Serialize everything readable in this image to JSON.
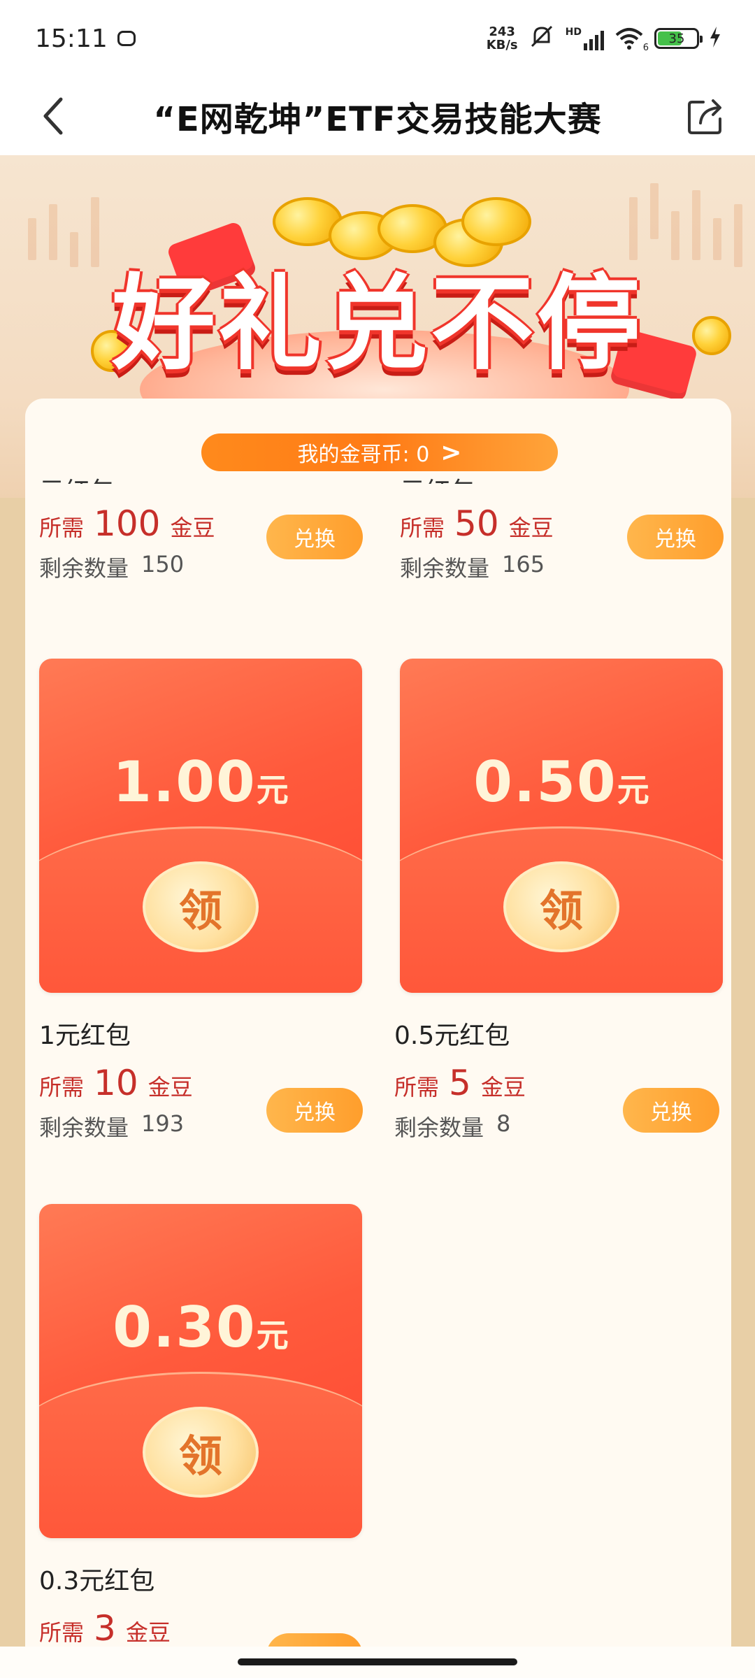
{
  "status_bar": {
    "time": "15:11",
    "net_speed_value": "243",
    "net_speed_unit": "KB/s",
    "hd": "HD",
    "wifi_level": "6",
    "battery": "35"
  },
  "nav": {
    "title": "“E网乾坤”ETF交易技能大赛"
  },
  "banner": {
    "headline": "好礼兑不停"
  },
  "wallet": {
    "label": "我的金哥币: 0",
    "arrow": ">"
  },
  "labels": {
    "need": "所需",
    "unit": "金豆",
    "remain": "剩余数量",
    "exchange": "兑换",
    "ling": "领",
    "yuan": "元"
  },
  "items": [
    {
      "title": "元红包",
      "amount": "",
      "price": "100",
      "remaining": "150"
    },
    {
      "title": "元红包",
      "amount": "",
      "price": "50",
      "remaining": "165"
    },
    {
      "title": "1元红包",
      "amount": "1.00",
      "price": "10",
      "remaining": "193"
    },
    {
      "title": "0.5元红包",
      "amount": "0.50",
      "price": "5",
      "remaining": "8"
    },
    {
      "title": "0.3元红包",
      "amount": "0.30",
      "price": "3",
      "remaining": ""
    }
  ]
}
